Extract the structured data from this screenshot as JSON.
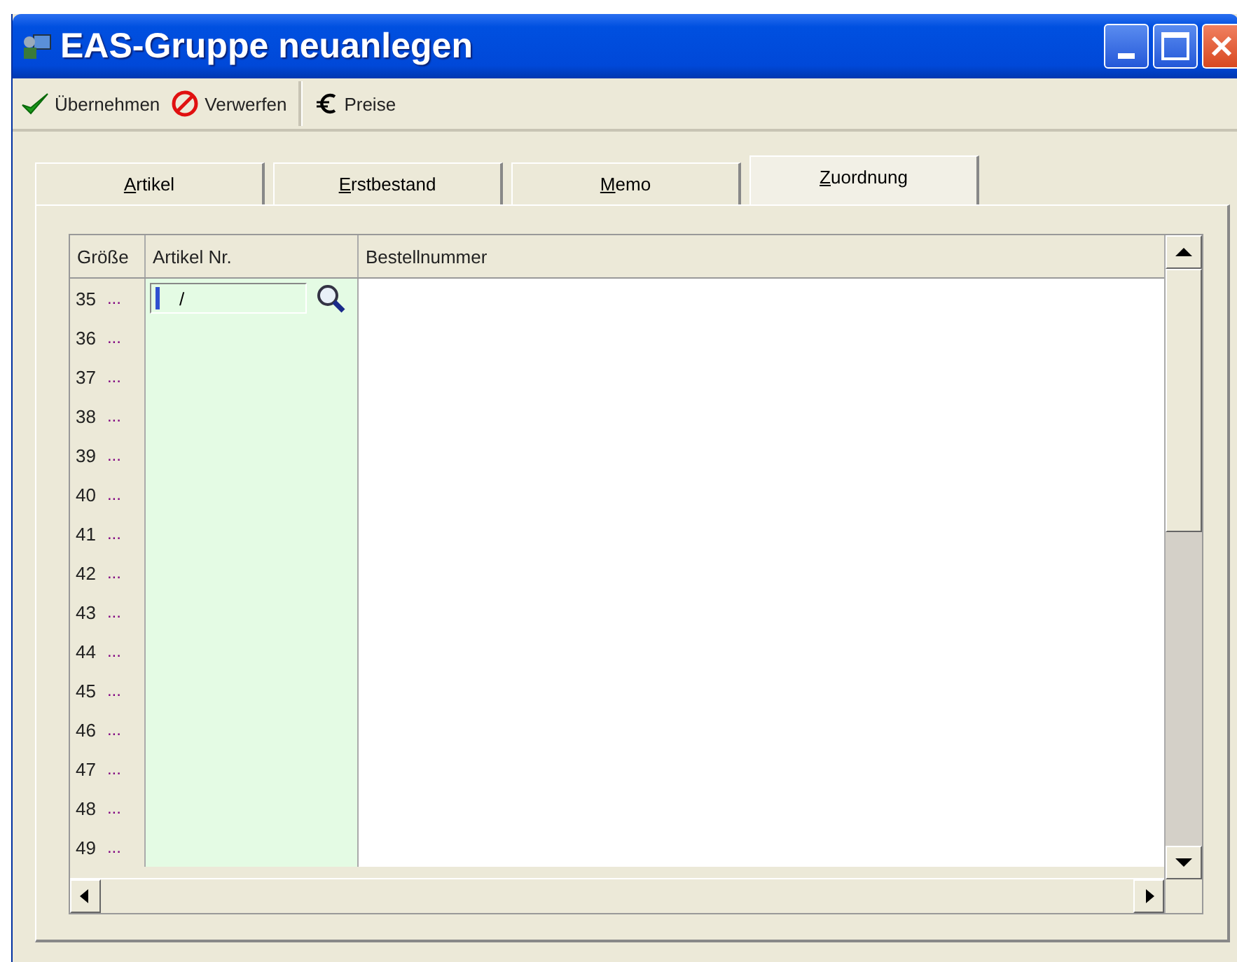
{
  "window": {
    "title": "EAS-Gruppe neuanlegen"
  },
  "toolbar": [
    {
      "label": "Übernehmen",
      "kind": "accept"
    },
    {
      "label": "Verwerfen",
      "kind": "discard"
    },
    {
      "label": "Preise",
      "kind": "prices"
    }
  ],
  "tabs": [
    {
      "label": "Artikel",
      "selected": false
    },
    {
      "label": "Erstbestand",
      "selected": false
    },
    {
      "label": "Memo",
      "selected": false
    },
    {
      "label": "Zuordnung",
      "selected": true
    }
  ],
  "table": {
    "columns": [
      "Größe",
      "Artikel Nr.",
      "Bestellnummer"
    ],
    "rows": [
      {
        "size": "35",
        "more": "...",
        "article_no": "/",
        "editing": true
      },
      {
        "size": "36",
        "more": "..."
      },
      {
        "size": "37",
        "more": "..."
      },
      {
        "size": "38",
        "more": "..."
      },
      {
        "size": "39",
        "more": "..."
      },
      {
        "size": "40",
        "more": "..."
      },
      {
        "size": "41",
        "more": "..."
      },
      {
        "size": "42",
        "more": "..."
      },
      {
        "size": "43",
        "more": "..."
      },
      {
        "size": "44",
        "more": "..."
      },
      {
        "size": "45",
        "more": "..."
      },
      {
        "size": "46",
        "more": "..."
      },
      {
        "size": "47",
        "more": "..."
      },
      {
        "size": "48",
        "more": "..."
      },
      {
        "size": "49",
        "more": "..."
      }
    ]
  }
}
